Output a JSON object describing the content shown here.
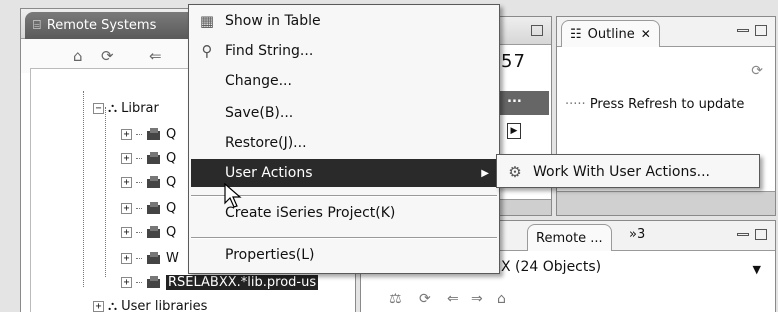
{
  "remote_systems_view": {
    "tab_label": "Remote Systems",
    "tree": {
      "libraries_label": "Librar",
      "rows": [
        {
          "label": "Q"
        },
        {
          "label": "Q"
        },
        {
          "label": "Q"
        },
        {
          "label": "Q"
        },
        {
          "label": "Q"
        },
        {
          "label": "W"
        }
      ],
      "selected_label": "RSELABXX.*lib.prod-us",
      "user_libraries_label": "User libraries"
    }
  },
  "middle_view": {
    "value_text": "57",
    "dots_text": "...",
    "remote_tab_label": "Remote ...",
    "overflow_label": "»3",
    "objects_text": "X (24 Objects)"
  },
  "outline_view": {
    "tab_label": "Outline",
    "message": "Press Refresh to update"
  },
  "context_menu": {
    "items": [
      {
        "label": "Show in Table",
        "icon": "table-icon"
      },
      {
        "label": "Find String...",
        "icon": "search-binoculars-icon"
      },
      {
        "label": "Change..."
      },
      {
        "label": "Save(B)..."
      },
      {
        "label": "Restore(J)..."
      },
      {
        "label": "User Actions",
        "highlighted": true,
        "has_submenu": true
      },
      {
        "label": "Create iSeries Project(K)"
      },
      {
        "label": "Properties(L)"
      }
    ]
  },
  "submenu": {
    "items": [
      {
        "label": "Work With User Actions...",
        "icon": "user-actions-icon"
      }
    ]
  }
}
